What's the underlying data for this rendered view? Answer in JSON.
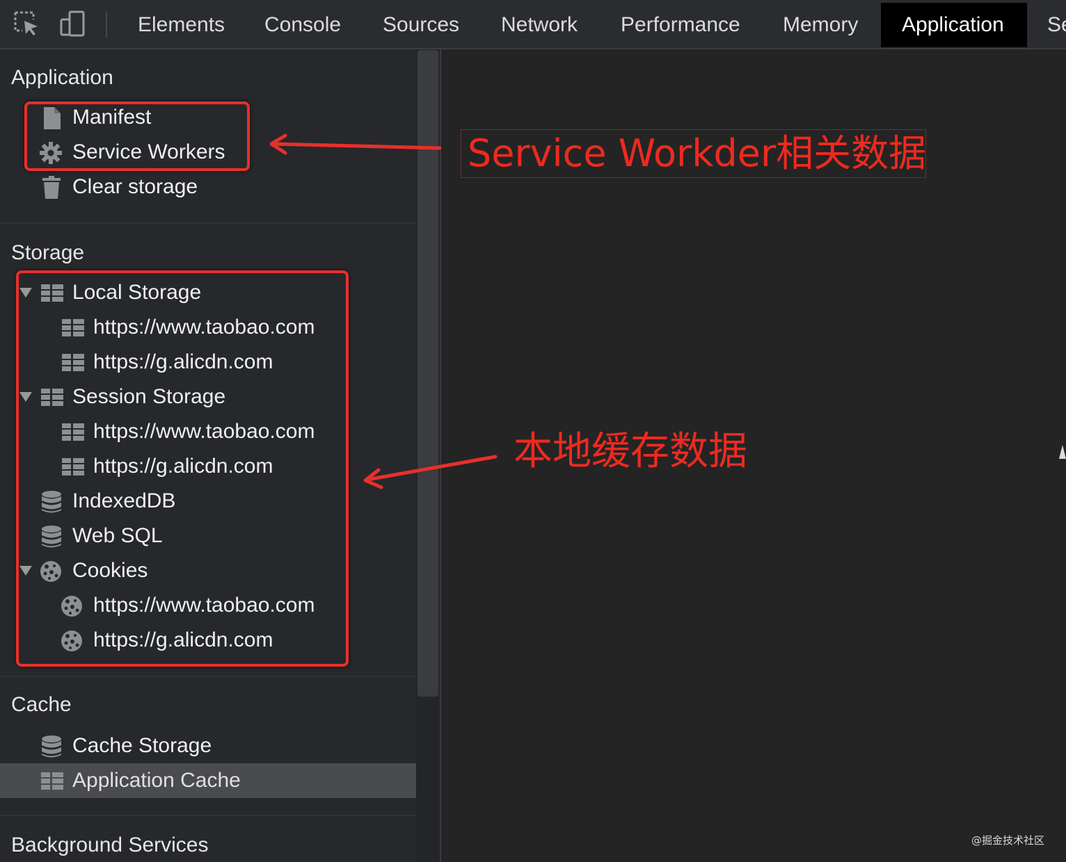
{
  "toolbar": {
    "inspect_icon": "inspect-element-icon",
    "device_icon": "device-toolbar-icon",
    "tabs": [
      {
        "label": "Elements"
      },
      {
        "label": "Console"
      },
      {
        "label": "Sources"
      },
      {
        "label": "Network"
      },
      {
        "label": "Performance"
      },
      {
        "label": "Memory"
      },
      {
        "label": "Application",
        "active": true
      },
      {
        "label": "Se"
      }
    ]
  },
  "sidebar": {
    "application": {
      "title": "Application",
      "items": [
        {
          "label": "Manifest",
          "icon": "file-icon"
        },
        {
          "label": "Service Workers",
          "icon": "gear-icon"
        },
        {
          "label": "Clear storage",
          "icon": "trash-icon"
        }
      ]
    },
    "storage": {
      "title": "Storage",
      "local_storage": {
        "label": "Local Storage",
        "icon": "grid-icon",
        "expanded": true,
        "children": [
          {
            "label": "https://www.taobao.com"
          },
          {
            "label": "https://g.alicdn.com"
          }
        ]
      },
      "session_storage": {
        "label": "Session Storage",
        "icon": "grid-icon",
        "expanded": true,
        "children": [
          {
            "label": "https://www.taobao.com"
          },
          {
            "label": "https://g.alicdn.com"
          }
        ]
      },
      "indexeddb": {
        "label": "IndexedDB",
        "icon": "database-icon"
      },
      "websql": {
        "label": "Web SQL",
        "icon": "database-icon"
      },
      "cookies": {
        "label": "Cookies",
        "icon": "cookie-icon",
        "expanded": true,
        "children": [
          {
            "label": "https://www.taobao.com"
          },
          {
            "label": "https://g.alicdn.com"
          }
        ]
      }
    },
    "cache": {
      "title": "Cache",
      "items": [
        {
          "label": "Cache Storage",
          "icon": "database-icon"
        },
        {
          "label": "Application Cache",
          "icon": "grid-icon",
          "selected": true
        }
      ]
    },
    "background_services": {
      "title": "Background Services"
    }
  },
  "annotations": {
    "service_worker_note": "Service Workder相关数据",
    "local_cache_note": "本地缓存数据",
    "color": "#e8302a"
  },
  "watermark": "@掘金技术社区"
}
